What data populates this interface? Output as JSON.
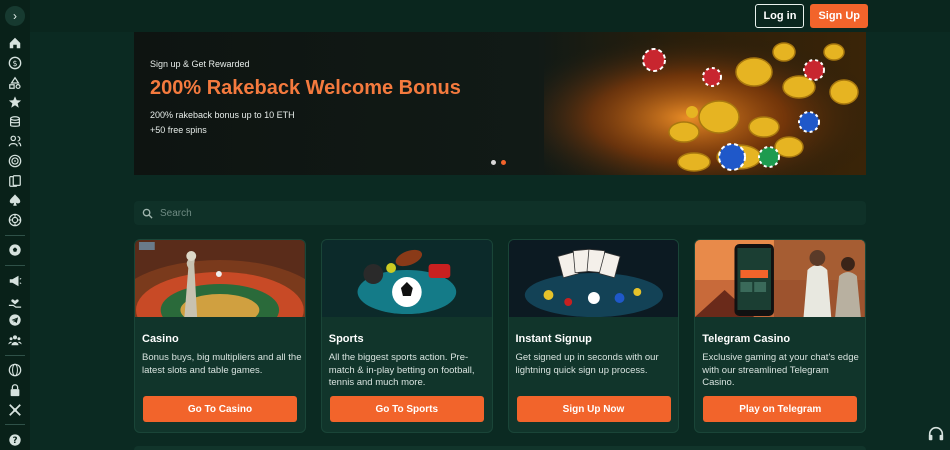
{
  "topbar": {
    "login_label": "Log in",
    "signup_label": "Sign Up"
  },
  "banner": {
    "subtitle": "Sign up & Get Rewarded",
    "title": "200% Rakeback Welcome Bonus",
    "line1": "200% rakeback bonus up to 10 ETH",
    "line2": "+50 free spins"
  },
  "search": {
    "placeholder": "Search"
  },
  "cards": [
    {
      "title": "Casino",
      "desc": "Bonus buys, big multipliers and all the latest slots and table games.",
      "button": "Go To Casino"
    },
    {
      "title": "Sports",
      "desc": "All the biggest sports action. Pre-match & in-play betting on football, tennis and much more.",
      "button": "Go To Sports"
    },
    {
      "title": "Instant Signup",
      "desc": "Get signed up in seconds with our lightning quick sign up process.",
      "button": "Sign Up Now"
    },
    {
      "title": "Telegram Casino",
      "desc": "Exclusive gaming at your chat's edge with our streamlined Telegram Casino.",
      "button": "Play on Telegram"
    }
  ],
  "colors": {
    "accent": "#f2642b",
    "background": "#0b2a22",
    "card": "#11352b"
  }
}
